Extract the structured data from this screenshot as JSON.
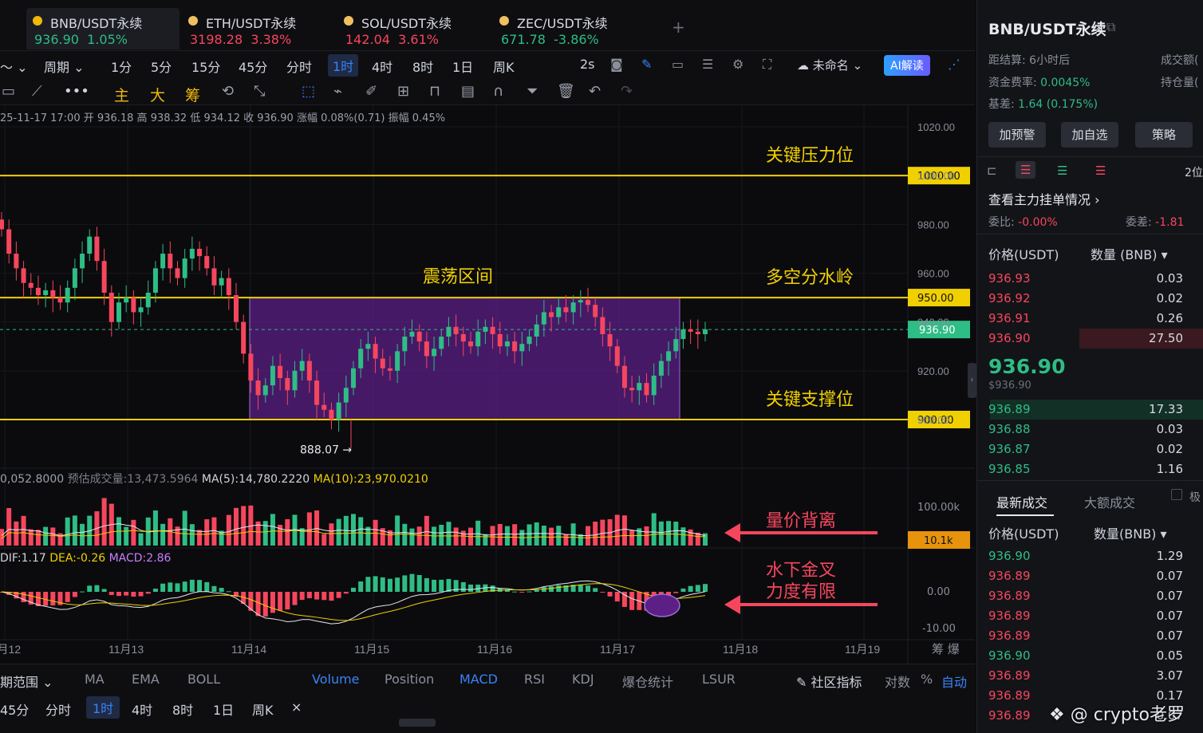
{
  "tabs": [
    {
      "pair": "BNB/USDT永续",
      "price": "936.90",
      "change": "1.05%",
      "dir": "up"
    },
    {
      "pair": "ETH/USDT永续",
      "price": "3198.28",
      "change": "3.38%",
      "dir": "dn"
    },
    {
      "pair": "SOL/USDT永续",
      "price": "142.04",
      "change": "3.61%",
      "dir": "dn"
    },
    {
      "pair": "ZEC/USDT永续",
      "price": "671.78",
      "change": "-3.86%",
      "dir": "up"
    }
  ],
  "toolbar": {
    "period_label": "周期",
    "intervals": [
      "1分",
      "5分",
      "15分",
      "45分",
      "分时",
      "1时",
      "4时",
      "8时",
      "1日",
      "周K"
    ],
    "selected_interval": "1时",
    "refresh": "2s",
    "layout_name": "未命名",
    "ai_label": "AI解读"
  },
  "drawing_tools": {
    "main": "主",
    "big": "大",
    "chips": "筹"
  },
  "ohlc": {
    "time": "25-11-17 17:00",
    "open_label": "开",
    "open": "936.18",
    "high_label": "高",
    "high": "938.32",
    "low_label": "低",
    "low": "934.12",
    "close_label": "收",
    "close": "936.90",
    "chg_label": "涨幅",
    "chg": "0.08%(0.71)",
    "amp_label": "振幅",
    "amp": "0.45%"
  },
  "chart_data": {
    "type": "candlestick",
    "ylim": [
      880,
      1020
    ],
    "y_ticks": [
      "1020.00",
      "1000.00",
      "980.00",
      "960.00",
      "940.00",
      "920.00",
      "900.00"
    ],
    "x_ticks": [
      "11月12",
      "11月13",
      "11月14",
      "11月15",
      "11月16",
      "11月17",
      "11月18",
      "11月19"
    ],
    "levels": [
      {
        "value": 1000,
        "label": "1000.00",
        "annotation": "关键压力位"
      },
      {
        "value": 950,
        "label": "950.00",
        "annotation": "多空分水岭"
      },
      {
        "value": 900,
        "label": "900.00",
        "annotation": "关键支撑位"
      }
    ],
    "current_price": "936.90",
    "range_box": {
      "top": 950,
      "bottom": 900,
      "label": "震荡区间"
    },
    "low_marker": "888.07",
    "closes": [
      978,
      968,
      962,
      956,
      954,
      951,
      953,
      950,
      948,
      954,
      962,
      968,
      975,
      965,
      952,
      940,
      948,
      950,
      944,
      946,
      952,
      962,
      968,
      962,
      958,
      966,
      970,
      967,
      962,
      955,
      958,
      951,
      940,
      927,
      916,
      910,
      914,
      922,
      917,
      912,
      920,
      924,
      916,
      906,
      904,
      900,
      907,
      913,
      921,
      929,
      931,
      925,
      921,
      920,
      928,
      934,
      936,
      932,
      926,
      929,
      934,
      938,
      935,
      932,
      930,
      936,
      938,
      935,
      930,
      932,
      928,
      931,
      934,
      939,
      944,
      942,
      946,
      944,
      948,
      949,
      947,
      942,
      935,
      930,
      922,
      913,
      912,
      915,
      910,
      918,
      924,
      928,
      933,
      937,
      936,
      935,
      937
    ],
    "volume": {
      "header_left": "0,052.8000",
      "predicted_label": "预估成交量:",
      "predicted": "13,473.5964",
      "ma5_label": "MA(5):",
      "ma5": "14,780.2220",
      "ma10_label": "MA(10):",
      "ma10": "23,970.0210",
      "ticks": [
        "100.00k"
      ],
      "current": "10.1k",
      "annotation": "量价背离"
    },
    "macd": {
      "dif_label": "DIF:",
      "dif": "1.17",
      "dea_label": "DEA:",
      "dea": "-0.26",
      "macd_label": "MACD:",
      "macd": "2.86",
      "ticks": [
        "0.00",
        "-10.00"
      ],
      "annotation_line1": "水下金叉",
      "annotation_line2": "力度有限"
    }
  },
  "indicator_bar": {
    "range_label": "期范围",
    "items": [
      "MA",
      "EMA",
      "BOLL",
      "Volume",
      "Position",
      "MACD",
      "RSI",
      "KDJ",
      "爆仓统计",
      "LSUR"
    ],
    "active": [
      "Volume",
      "MACD"
    ],
    "community": "社区指标",
    "log": "对数",
    "pct": "%",
    "auto": "自动"
  },
  "range_bar": {
    "items": [
      "45分",
      "分时",
      "1时",
      "4时",
      "8时",
      "1日",
      "周K"
    ],
    "selected": "1时",
    "close": "×"
  },
  "right_panel": {
    "title": "BNB/USDT永续",
    "settle_label": "距结算:",
    "settle": "6小时后",
    "turnover_label": "成交额(",
    "funding_label": "资金费率:",
    "funding": "0.0045%",
    "oi_label": "持仓量(",
    "basis_label": "基差:",
    "basis": "1.64 (0.175%)",
    "buttons": [
      "加预警",
      "加自选",
      "策略"
    ],
    "depth_label": "2位",
    "orders_link": "查看主力挂单情况",
    "ratio_label": "委比:",
    "ratio": "-0.00%",
    "diff_label": "委差:",
    "diff": "-1.81",
    "price_header": "价格(USDT)",
    "qty_header": "数量 (BNB)",
    "asks": [
      {
        "price": "936.93",
        "qty": "0.03"
      },
      {
        "price": "936.92",
        "qty": "0.02"
      },
      {
        "price": "936.91",
        "qty": "0.26"
      },
      {
        "price": "936.90",
        "qty": "27.50"
      }
    ],
    "last_price": "936.90",
    "last_price_usd": "$936.90",
    "bids": [
      {
        "price": "936.89",
        "qty": "17.33"
      },
      {
        "price": "936.88",
        "qty": "0.03"
      },
      {
        "price": "936.87",
        "qty": "0.02"
      },
      {
        "price": "936.85",
        "qty": "1.16"
      }
    ],
    "trades_tab": "最新成交",
    "big_trades_tab": "大额成交",
    "big_trades_extra": "极",
    "trades_price_header": "价格(USDT)",
    "trades_qty_header": "数量(BNB)",
    "trades": [
      {
        "price": "936.90",
        "qty": "1.29",
        "dir": "up"
      },
      {
        "price": "936.89",
        "qty": "0.07",
        "dir": "dn"
      },
      {
        "price": "936.89",
        "qty": "0.07",
        "dir": "dn"
      },
      {
        "price": "936.89",
        "qty": "0.07",
        "dir": "dn"
      },
      {
        "price": "936.89",
        "qty": "0.07",
        "dir": "dn"
      },
      {
        "price": "936.90",
        "qty": "0.05",
        "dir": "up"
      },
      {
        "price": "936.89",
        "qty": "3.07",
        "dir": "dn"
      },
      {
        "price": "936.89",
        "qty": "0.17",
        "dir": "dn"
      },
      {
        "price": "936.89",
        "qty": "0.07",
        "dir": "dn"
      }
    ]
  },
  "watermark": "@ crypto老罗",
  "colors": {
    "up": "#2ebd85",
    "down": "#f6465d",
    "level": "#f0d000",
    "box": "#5b1f86",
    "accent": "#3b82f6"
  }
}
